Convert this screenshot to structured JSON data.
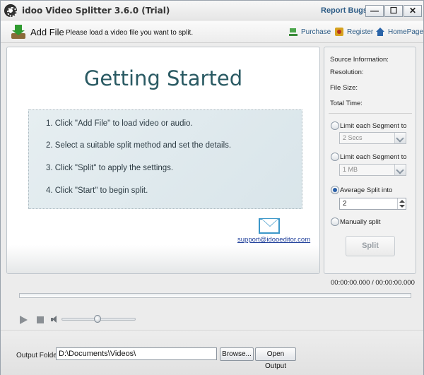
{
  "window": {
    "title": "idoo Video Splitter 3.6.0 (Trial)",
    "report_bugs": "Report Bugs",
    "minimize": "—",
    "maximize": "☐",
    "close": "✕"
  },
  "toolbar": {
    "add_file": "Add File",
    "hint": "Please load a video file you want to split.",
    "links": {
      "purchase": "Purchase",
      "register": "Register",
      "homepage": "HomePage"
    },
    "icons": {
      "add_file": "add-file-icon",
      "purchase": "cart-icon",
      "register": "register-icon",
      "homepage": "home-icon"
    }
  },
  "main": {
    "heading": "Getting Started",
    "steps": [
      "1. Click \"Add File\" to load video or audio.",
      "2. Select a suitable split method and set the details.",
      "3. Click \"Split\" to apply the settings.",
      "4. Click \"Start\" to begin split."
    ],
    "support_email": "support@idooeditor.com",
    "support_icon": "mail-icon"
  },
  "info": {
    "source": "Source Information:",
    "resolution": "Resolution:",
    "file_size": "File Size:",
    "total_time": "Total Time:"
  },
  "split_options": {
    "by_time_label": "Limit each Segment to",
    "by_time_value": "2 Secs",
    "by_size_label": "Limit each Segment to",
    "by_size_value": "1 MB",
    "average_label": "Average Split into",
    "average_value": "2",
    "manual_label": "Manually split",
    "selected": "average",
    "split_button": "Split"
  },
  "player": {
    "time": "00:00:00.000 / 00:00:00.000",
    "progress": 0,
    "volume": 0.5
  },
  "output": {
    "label": "Output Folder:",
    "path": "D:\\Documents\\Videos\\",
    "browse": "Browse...",
    "open_output": "Open Output"
  },
  "colors": {
    "accent": "#2a5a63",
    "link": "#2d5c86",
    "email_link": "#1f3f9a",
    "selected_radio": "#2a5fa8"
  }
}
